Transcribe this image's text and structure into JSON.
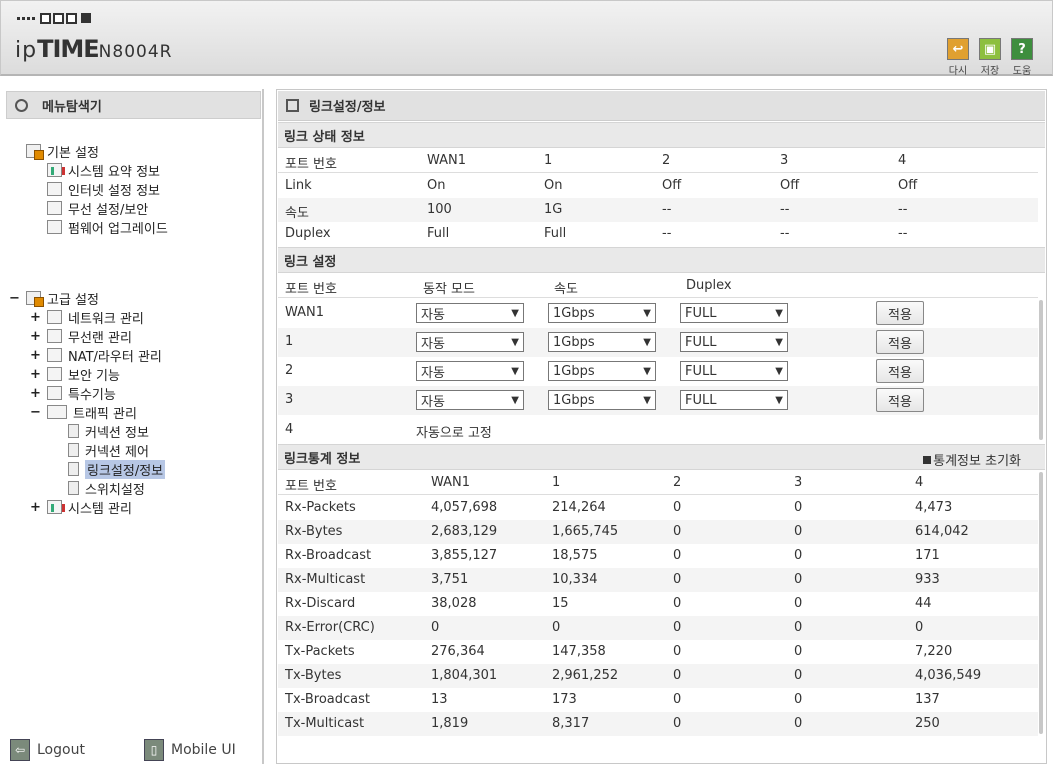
{
  "header": {
    "brand_ip": "ip",
    "brand_time": "TIME",
    "model": "N8004R",
    "buttons": [
      {
        "label": "다시",
        "icon": "undo-icon",
        "color": "#e0a030"
      },
      {
        "label": "저장",
        "icon": "save-icon",
        "color": "#8dbf3f"
      },
      {
        "label": "도움",
        "icon": "help-icon",
        "color": "#3e8e3e"
      }
    ]
  },
  "sidebar": {
    "title": "메뉴탐색기",
    "basic_group": "기본 설정",
    "basic_items": [
      "시스템 요약 정보",
      "인터넷 설정 정보",
      "무선 설정/보안",
      "펌웨어 업그레이드"
    ],
    "advanced_group": "고급 설정",
    "advanced_items": [
      "네트워크 관리",
      "무선랜 관리",
      "NAT/라우터 관리",
      "보안 기능",
      "특수기능",
      "트래픽 관리"
    ],
    "traffic_items": [
      "커넥션 정보",
      "커넥션 제어",
      "링크설정/정보",
      "스위치설정"
    ],
    "system_item": "시스템 관리",
    "logout": "Logout",
    "mobile": "Mobile UI"
  },
  "main": {
    "title": "링크설정/정보",
    "link_status": {
      "title": "링크 상태 정보",
      "headers": [
        "포트 번호",
        "WAN1",
        "1",
        "2",
        "3",
        "4"
      ],
      "rows": [
        [
          "Link",
          "On",
          "On",
          "Off",
          "Off",
          "Off"
        ],
        [
          "속도",
          "100",
          "1G",
          "--",
          "--",
          "--"
        ],
        [
          "Duplex",
          "Full",
          "Full",
          "--",
          "--",
          "--"
        ]
      ]
    },
    "link_settings": {
      "title": "링크 설정",
      "headers": [
        "포트 번호",
        "동작 모드",
        "속도",
        "Duplex"
      ],
      "rows": [
        {
          "port": "WAN1",
          "mode": "자동",
          "speed": "1Gbps",
          "duplex": "FULL",
          "apply": "적용"
        },
        {
          "port": "1",
          "mode": "자동",
          "speed": "1Gbps",
          "duplex": "FULL",
          "apply": "적용"
        },
        {
          "port": "2",
          "mode": "자동",
          "speed": "1Gbps",
          "duplex": "FULL",
          "apply": "적용"
        },
        {
          "port": "3",
          "mode": "자동",
          "speed": "1Gbps",
          "duplex": "FULL",
          "apply": "적용"
        }
      ],
      "fixed_port": "4",
      "fixed_text": "자동으로 고정"
    },
    "link_stats": {
      "title": "링크통계 정보",
      "reset": "통계정보 초기화",
      "headers": [
        "포트 번호",
        "WAN1",
        "1",
        "2",
        "3",
        "4"
      ],
      "rows": [
        [
          "Rx-Packets",
          "4,057,698",
          "214,264",
          "0",
          "0",
          "4,473"
        ],
        [
          "Rx-Bytes",
          "2,683,129",
          "1,665,745",
          "0",
          "0",
          "614,042"
        ],
        [
          "Rx-Broadcast",
          "3,855,127",
          "18,575",
          "0",
          "0",
          "171"
        ],
        [
          "Rx-Multicast",
          "3,751",
          "10,334",
          "0",
          "0",
          "933"
        ],
        [
          "Rx-Discard",
          "38,028",
          "15",
          "0",
          "0",
          "44"
        ],
        [
          "Rx-Error(CRC)",
          "0",
          "0",
          "0",
          "0",
          "0"
        ],
        [
          "Tx-Packets",
          "276,364",
          "147,358",
          "0",
          "0",
          "7,220"
        ],
        [
          "Tx-Bytes",
          "1,804,301",
          "2,961,252",
          "0",
          "0",
          "4,036,549"
        ],
        [
          "Tx-Broadcast",
          "13",
          "173",
          "0",
          "0",
          "137"
        ],
        [
          "Tx-Multicast",
          "1,819",
          "8,317",
          "0",
          "0",
          "250"
        ]
      ]
    }
  }
}
